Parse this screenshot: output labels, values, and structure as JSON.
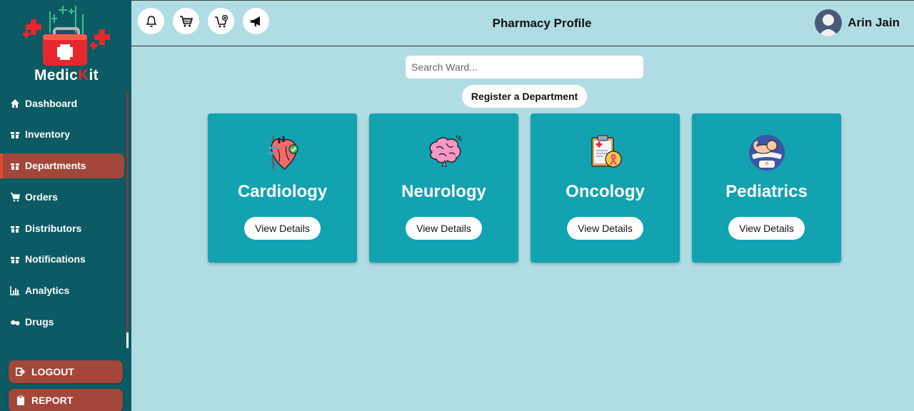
{
  "app": {
    "logo_text_a": "Medic",
    "logo_text_b": "K",
    "logo_text_c": "it"
  },
  "sidebar": {
    "items": [
      {
        "label": "Dashboard",
        "icon": "home-icon"
      },
      {
        "label": "Inventory",
        "icon": "gift-icon"
      },
      {
        "label": "Departments",
        "icon": "gift-icon",
        "active": true
      },
      {
        "label": "Orders",
        "icon": "cart-icon"
      },
      {
        "label": "Distributors",
        "icon": "gift-icon"
      },
      {
        "label": "Notifications",
        "icon": "gift-icon"
      },
      {
        "label": "Analytics",
        "icon": "chart-icon"
      },
      {
        "label": "Drugs",
        "icon": "pills-icon"
      }
    ],
    "logout_label": "LOGOUT",
    "report_label": "REPORT"
  },
  "header": {
    "title": "Pharmacy Profile",
    "user_name": "Arin Jain",
    "icons": [
      "bell-icon",
      "cart-icon",
      "cart-plus-icon",
      "megaphone-icon"
    ]
  },
  "main": {
    "search_placeholder": "Search Ward...",
    "register_label": "Register a Department",
    "cards": [
      {
        "title": "Cardiology",
        "button": "View Details",
        "icon": "heart-icon"
      },
      {
        "title": "Neurology",
        "button": "View Details",
        "icon": "brain-icon"
      },
      {
        "title": "Oncology",
        "button": "View Details",
        "icon": "clipboard-ribbon-icon"
      },
      {
        "title": "Pediatrics",
        "button": "View Details",
        "icon": "baby-icon"
      }
    ]
  },
  "colors": {
    "sidebar_bg": "#0c5a63",
    "accent_red": "#a3473a",
    "page_bg": "#b0dde4",
    "card_bg": "#12a2b0"
  }
}
